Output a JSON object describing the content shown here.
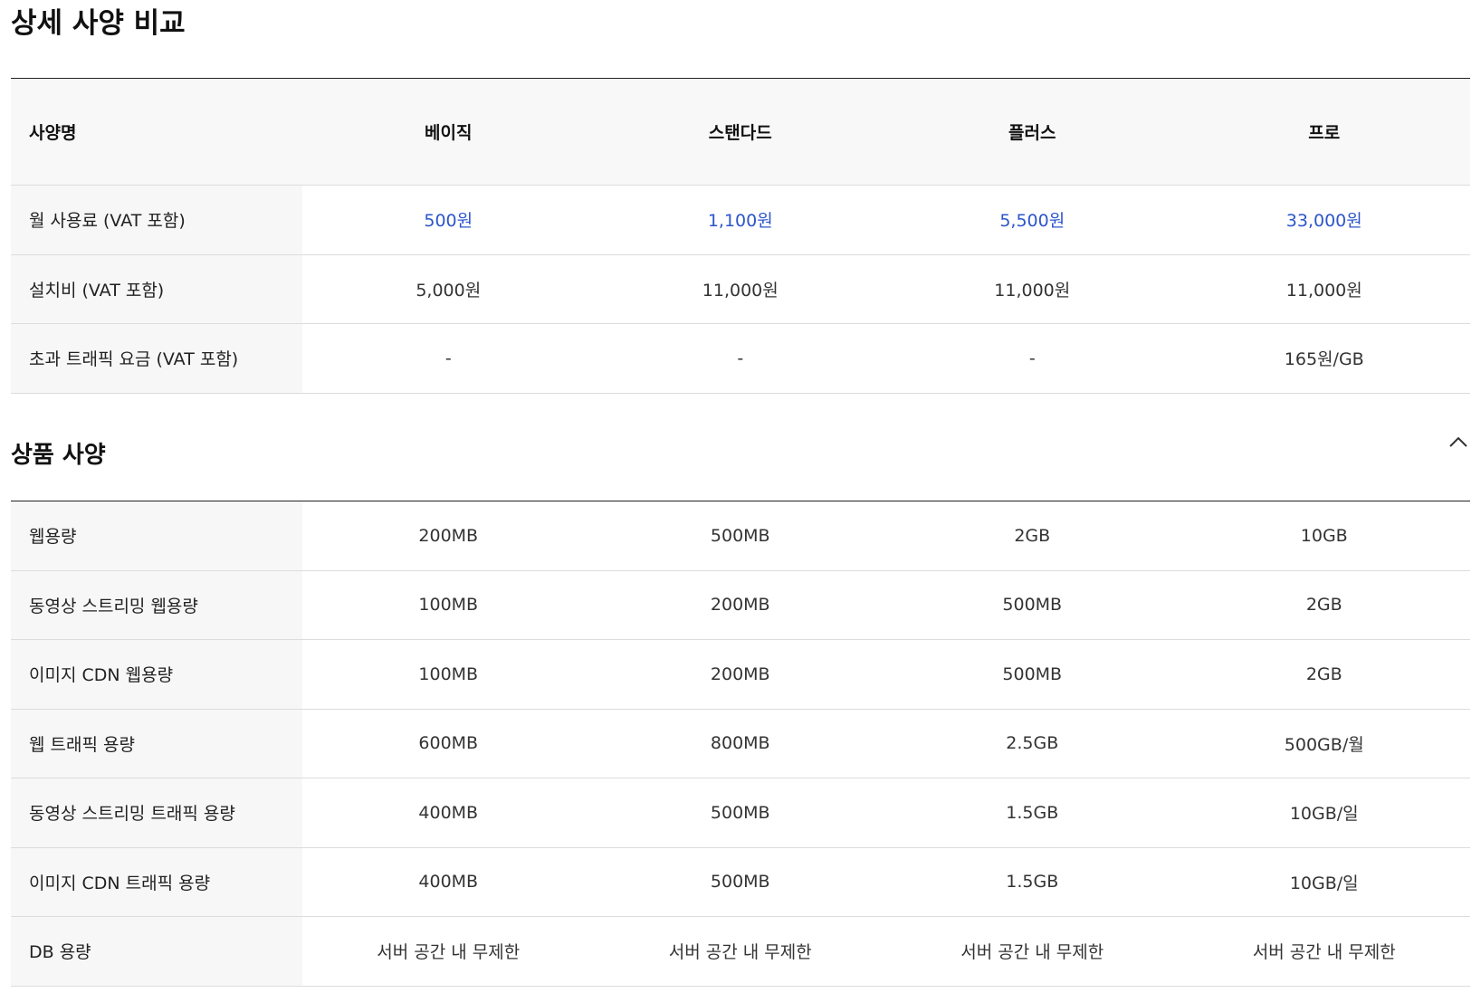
{
  "section1": {
    "title": "상세 사양 비교",
    "columns": [
      "사양명",
      "베이직",
      "스탠다드",
      "플러스",
      "프로"
    ],
    "rows": [
      {
        "label": "월 사용료 (VAT 포함)",
        "values": [
          "500원",
          "1,100원",
          "5,500원",
          "33,000원"
        ]
      },
      {
        "label": "설치비 (VAT 포함)",
        "values": [
          "5,000원",
          "11,000원",
          "11,000원",
          "11,000원"
        ]
      },
      {
        "label": "초과 트래픽 요금 (VAT 포함)",
        "values": [
          "-",
          "-",
          "-",
          "165원/GB"
        ]
      }
    ]
  },
  "section2": {
    "title": "상품 사양",
    "toggle_icon": "chevron-up-icon",
    "rows": [
      {
        "label": "웹용량",
        "values": [
          "200MB",
          "500MB",
          "2GB",
          "10GB"
        ]
      },
      {
        "label": "동영상 스트리밍 웹용량",
        "values": [
          "100MB",
          "200MB",
          "500MB",
          "2GB"
        ]
      },
      {
        "label": "이미지 CDN 웹용량",
        "values": [
          "100MB",
          "200MB",
          "500MB",
          "2GB"
        ]
      },
      {
        "label": "웹 트래픽 용량",
        "values": [
          "600MB",
          "800MB",
          "2.5GB",
          "500GB/월"
        ]
      },
      {
        "label": "동영상 스트리밍 트래픽 용량",
        "values": [
          "400MB",
          "500MB",
          "1.5GB",
          "10GB/일"
        ]
      },
      {
        "label": "이미지 CDN 트래픽 용량",
        "values": [
          "400MB",
          "500MB",
          "1.5GB",
          "10GB/일"
        ]
      },
      {
        "label": "DB 용량",
        "values": [
          "서버 공간 내 무제한",
          "서버 공간 내 무제한",
          "서버 공간 내 무제한",
          "서버 공간 내 무제한"
        ]
      }
    ]
  },
  "colors": {
    "price": "#2c55c9",
    "header_bg": "#f8f8f8",
    "label_bg": "#f7f7f7",
    "border": "#dcdcdc"
  }
}
